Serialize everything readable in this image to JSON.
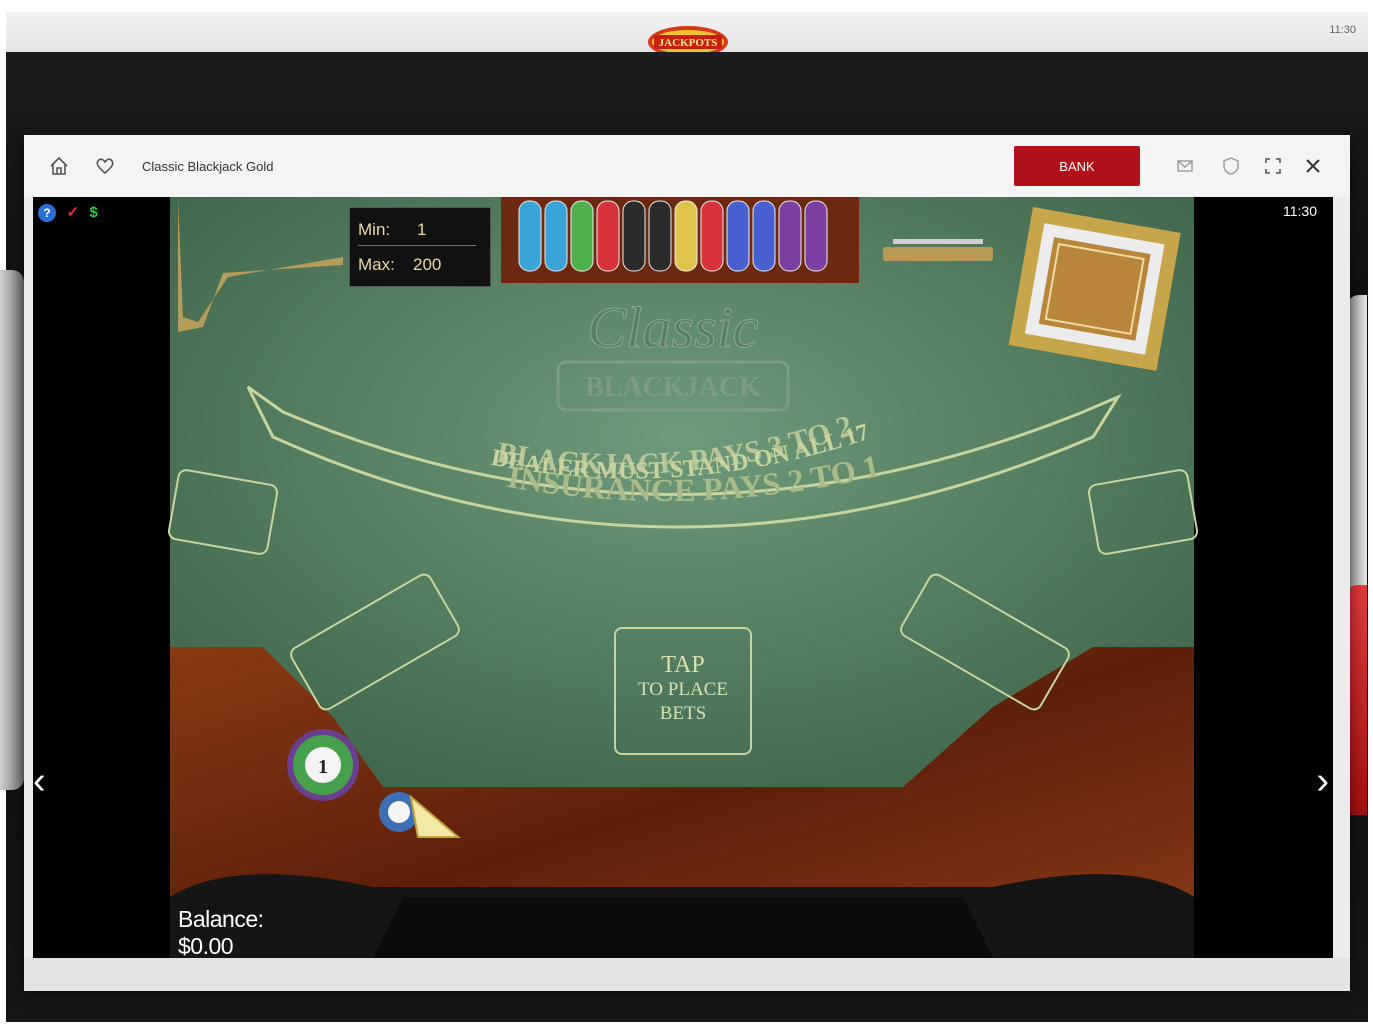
{
  "topbar": {
    "clock": "11:30",
    "logo_text": "JACKPOTS"
  },
  "window": {
    "title": "Classic Blackjack Gold",
    "bank_label": "BANK"
  },
  "game": {
    "clock": "11:30",
    "help_symbol": "?",
    "check_symbol": "✓",
    "dollar_symbol": "$",
    "min_label": "Min:",
    "min_value": "1",
    "max_label": "Max:",
    "max_value": "200",
    "logo_script": "Classic",
    "logo_box": "BLACKJACK",
    "arc1": "BLACKJACK PAYS 3 TO 2",
    "arc2": "DEALER MUST STAND ON ALL 17",
    "arc3": "INSURANCE PAYS 2 TO 1",
    "tap_line1": "TAP",
    "tap_line2": "TO PLACE",
    "tap_line3": "BETS",
    "chip_value": "1",
    "balance_label": "Balance:",
    "balance_value": "$0.00",
    "prev_arrow": "‹",
    "next_arrow": "›"
  },
  "colors": {
    "bank": "#b0121a",
    "felt": "#4f7a5b",
    "wood": "#6b2a10"
  }
}
